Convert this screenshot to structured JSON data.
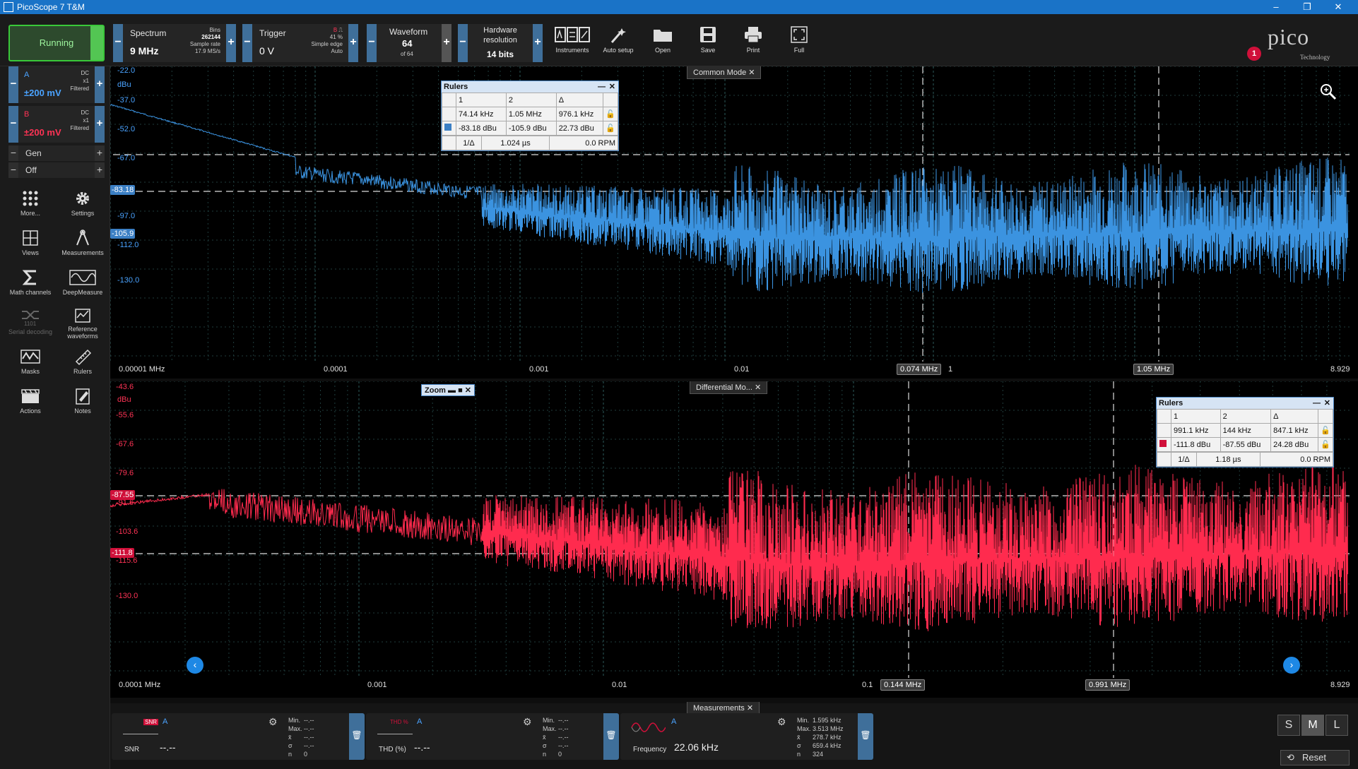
{
  "window": {
    "title": "PicoScope 7 T&M",
    "minimize": "–",
    "maximize": "❐",
    "close": "✕"
  },
  "toolbar": {
    "run_label": "Running",
    "spectrum": {
      "title": "Spectrum",
      "value": "9 MHz",
      "bins_label": "Bins",
      "bins": "262144",
      "sample_rate_label": "Sample rate",
      "sample_rate": "17.9 MS/s"
    },
    "trigger": {
      "title": "Trigger",
      "value": "0 V",
      "channel": "B",
      "pct": "41 %",
      "type": "Simple edge",
      "mode": "Auto"
    },
    "waveform": {
      "title": "Waveform",
      "value": "64",
      "of": "of 64"
    },
    "hardware": {
      "title": "Hardware resolution",
      "value": "14 bits"
    },
    "buttons": [
      {
        "label": "Instruments",
        "icon": "instruments-icon"
      },
      {
        "label": "Auto setup",
        "icon": "auto-setup-icon"
      },
      {
        "label": "Open",
        "icon": "folder-icon"
      },
      {
        "label": "Save",
        "icon": "save-icon"
      },
      {
        "label": "Print",
        "icon": "print-icon"
      },
      {
        "label": "Full",
        "icon": "fullscreen-icon"
      }
    ],
    "logo_text": "pico",
    "logo_sub": "Technology",
    "notification_count": "1"
  },
  "channels": [
    {
      "letter": "A",
      "range": "±200 mV",
      "coupling": "DC",
      "probe": "x1",
      "filter": "Filtered",
      "color": "#4aa3ff"
    },
    {
      "letter": "B",
      "range": "±200 mV",
      "coupling": "DC",
      "probe": "x1",
      "filter": "Filtered",
      "color": "#ff3355"
    }
  ],
  "generator": {
    "label": "Gen",
    "state": "Off"
  },
  "side_tools": [
    {
      "label": "More...",
      "icon": "more-icon"
    },
    {
      "label": "Settings",
      "icon": "gear-icon"
    },
    {
      "label": "Views",
      "icon": "views-icon"
    },
    {
      "label": "Measurements",
      "icon": "measurements-icon"
    },
    {
      "label": "Math channels",
      "icon": "sigma-icon"
    },
    {
      "label": "DeepMeasure",
      "icon": "deepmeasure-icon"
    },
    {
      "label": "Serial decoding",
      "icon": "serial-icon"
    },
    {
      "label": "Reference waveforms",
      "icon": "reference-icon"
    },
    {
      "label": "Masks",
      "icon": "masks-icon"
    },
    {
      "label": "Rulers",
      "icon": "ruler-icon"
    },
    {
      "label": "Actions",
      "icon": "actions-icon"
    },
    {
      "label": "Notes",
      "icon": "notes-icon"
    }
  ],
  "top_view": {
    "tab": "Common Mode",
    "unit": "dBu",
    "y_ticks": [
      "-22.0",
      "-37.0",
      "-52.0",
      "-67.0",
      "-97.0",
      "-112.0",
      "-130.0"
    ],
    "ruler_y_badges": [
      "-83.18",
      "-105.9"
    ],
    "x_ticks": [
      "0.00001 MHz",
      "0.0001",
      "0.001",
      "0.01",
      "1",
      "8.929"
    ],
    "ruler_x_flags": [
      "0.074 MHz",
      "1.05 MHz"
    ],
    "rulers": {
      "title": "Rulers",
      "h1": "1",
      "h2": "2",
      "hd": "Δ",
      "x1": "74.14 kHz",
      "x2": "1.05 MHz",
      "xd": "976.1 kHz",
      "y1": "-83.18 dBu",
      "y2": "-105.9 dBu",
      "yd": "22.73 dBu",
      "inv_label": "1/Δ",
      "inv": "1.024 µs",
      "rpm": "0.0 RPM"
    }
  },
  "bottom_view": {
    "tab": "Differential Mo...",
    "zoom_label": "Zoom",
    "unit": "dBu",
    "y_ticks": [
      "-43.6",
      "-55.6",
      "-67.6",
      "-79.6",
      "-91.6",
      "-103.6",
      "-115.6",
      "-130.0"
    ],
    "ruler_y_badges": [
      "-87.55",
      "-111.8"
    ],
    "x_ticks": [
      "0.0001 MHz",
      "0.001",
      "0.01",
      "0.1",
      "8.929"
    ],
    "ruler_x_flags": [
      "0.144 MHz",
      "0.991 MHz"
    ],
    "rulers": {
      "title": "Rulers",
      "h1": "1",
      "h2": "2",
      "hd": "Δ",
      "x1": "991.1 kHz",
      "x2": "144 kHz",
      "xd": "847.1 kHz",
      "y1": "-111.8 dBu",
      "y2": "-87.55 dBu",
      "yd": "24.28 dBu",
      "inv_label": "1/Δ",
      "inv": "1.18 µs",
      "rpm": "0.0 RPM"
    }
  },
  "measurements": {
    "tab": "Measurements",
    "cards": [
      {
        "name": "SNR",
        "channel": "A",
        "value": "--.--",
        "icon_text": "SNR",
        "stats": {
          "min": "--.--",
          "max": "--.--",
          "mean": "--.--",
          "sigma": "--.--",
          "n": "0"
        }
      },
      {
        "name": "THD (%)",
        "channel": "A",
        "value": "--.--",
        "icon_text": "THD %",
        "stats": {
          "min": "--.--",
          "max": "--.--",
          "mean": "--.--",
          "sigma": "--.--",
          "n": "0"
        }
      },
      {
        "name": "Frequency",
        "channel": "A",
        "value": "22.06 kHz",
        "icon_text": "",
        "stats": {
          "min": "1.595 kHz",
          "max": "3.513 MHz",
          "mean": "278.7 kHz",
          "sigma": "659.4 kHz",
          "n": "324"
        }
      }
    ],
    "stat_labels": {
      "min": "Min.",
      "max": "Max.",
      "mean": "x̄",
      "sigma": "σ",
      "n": "n"
    },
    "size_buttons": [
      "S",
      "M",
      "L"
    ],
    "reset_label": "Reset"
  }
}
